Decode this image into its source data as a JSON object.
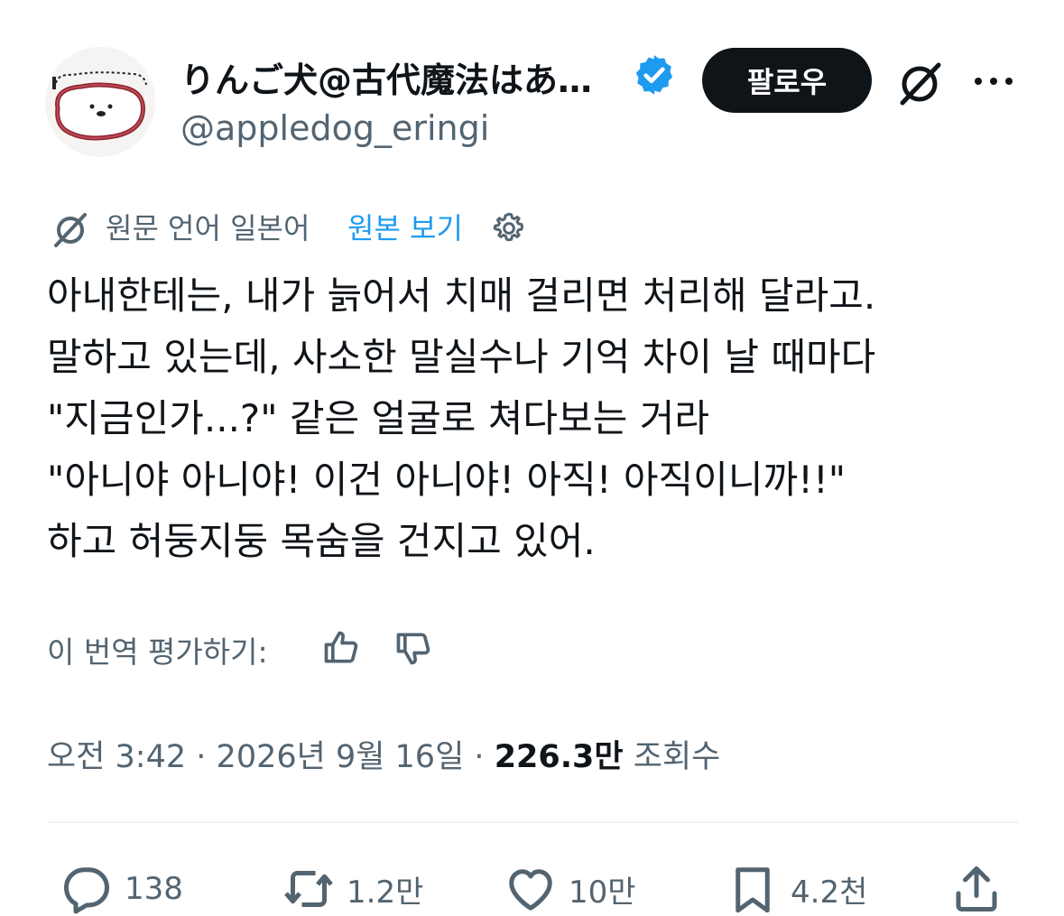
{
  "header": {
    "display_name": "りんご犬@古代魔法はあ…",
    "handle": "@appledog_eringi",
    "follow_label": "팔로우"
  },
  "translation": {
    "source_text": "원문 언어 일본어",
    "view_original_label": "원본 보기"
  },
  "tweet": {
    "lines": [
      "아내한테는, 내가 늙어서 치매 걸리면 처리해 달라고.",
      "말하고 있는데, 사소한 말실수나 기억 차이 날 때마다",
      "\"지금인가...?\" 같은 얼굴로 쳐다보는 거라",
      "\"아니야 아니야! 이건 아니야! 아직! 아직이니까!!\"",
      "하고 허둥지둥 목숨을 건지고 있어."
    ]
  },
  "rating": {
    "label": "이 번역 평가하기:"
  },
  "meta": {
    "time": "오전 3:42",
    "separator": "·",
    "date": "2026년 9월 16일",
    "views_count": "226.3만",
    "views_label": "조회수"
  },
  "actions": {
    "replies": "138",
    "reposts": "1.2만",
    "likes": "10만",
    "bookmarks": "4.2천"
  },
  "colors": {
    "text": "#0f1419",
    "secondary": "#536471",
    "link": "#1d9bf0",
    "verified": "#1d9bf0",
    "divider": "#eff3f4"
  }
}
